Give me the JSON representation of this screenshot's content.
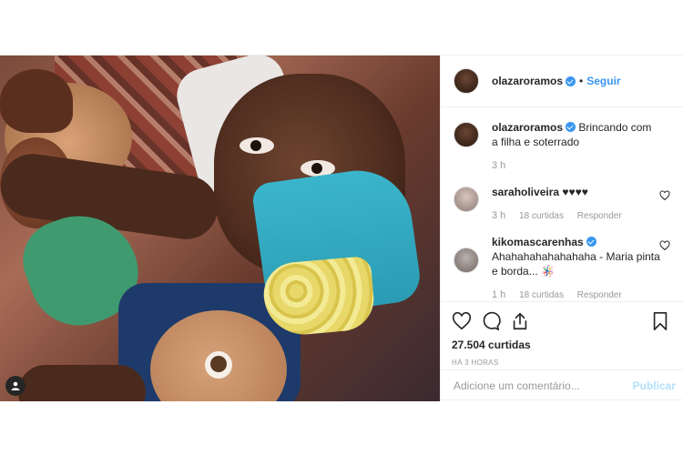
{
  "header": {
    "username": "olazaroramos",
    "separator": "•",
    "follow_label": "Seguir"
  },
  "caption": {
    "username": "olazaroramos",
    "text": "Brincando com a filha e soterrado",
    "time": "3 h"
  },
  "comments": [
    {
      "username": "saraholiveira",
      "text": "♥♥♥♥",
      "time": "3 h",
      "likes": "18 curtidas",
      "reply": "Responder"
    },
    {
      "username": "kikomascarenhas",
      "text": "Ahahahahahahahaha - Maria pinta e borda...",
      "emoji": "🪅",
      "time": "1 h",
      "likes": "18 curtidas",
      "reply": "Responder"
    }
  ],
  "likes_count": "27.504 curtidas",
  "posted_ago": "HÁ 3 HORAS",
  "comment_box": {
    "placeholder": "Adicione um comentário...",
    "publish_label": "Publicar"
  },
  "icons": {
    "like": "heart-icon",
    "comment": "comment-icon",
    "share": "share-icon",
    "save": "bookmark-icon",
    "tag": "user-tag-icon"
  },
  "colors": {
    "accent": "#3897f0",
    "publish_disabled": "#b2dffc",
    "muted": "#999999"
  }
}
